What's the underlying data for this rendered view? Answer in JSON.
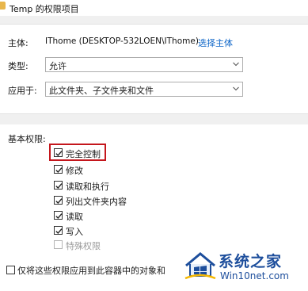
{
  "window": {
    "title": "Temp 的权限项目"
  },
  "entry": {
    "principal_label": "主体:",
    "principal_value": "IThome (DESKTOP-532LOEN\\IThome)",
    "select_principal_link": "选择主体",
    "type_label": "类型:",
    "type_value": "允许",
    "applies_to_label": "应用于:",
    "applies_to_value": "此文件夹、子文件夹和文件"
  },
  "permissions": {
    "heading": "基本权限:",
    "items": [
      {
        "label": "完全控制",
        "checked": true,
        "enabled": true,
        "highlighted": true
      },
      {
        "label": "修改",
        "checked": true,
        "enabled": true
      },
      {
        "label": "读取和执行",
        "checked": true,
        "enabled": true
      },
      {
        "label": "列出文件夹内容",
        "checked": true,
        "enabled": true
      },
      {
        "label": "读取",
        "checked": true,
        "enabled": true
      },
      {
        "label": "写入",
        "checked": true,
        "enabled": true
      },
      {
        "label": "特殊权限",
        "checked": false,
        "enabled": false
      }
    ],
    "apply_only_label": "仅将这些权限应用到此容器中的对象和"
  },
  "watermark": {
    "text": "系统之家",
    "sub": "Win10net.com"
  },
  "colors": {
    "link": "#0a63c7",
    "highlight": "#c4161c",
    "watermark": "#1d4e9c"
  }
}
